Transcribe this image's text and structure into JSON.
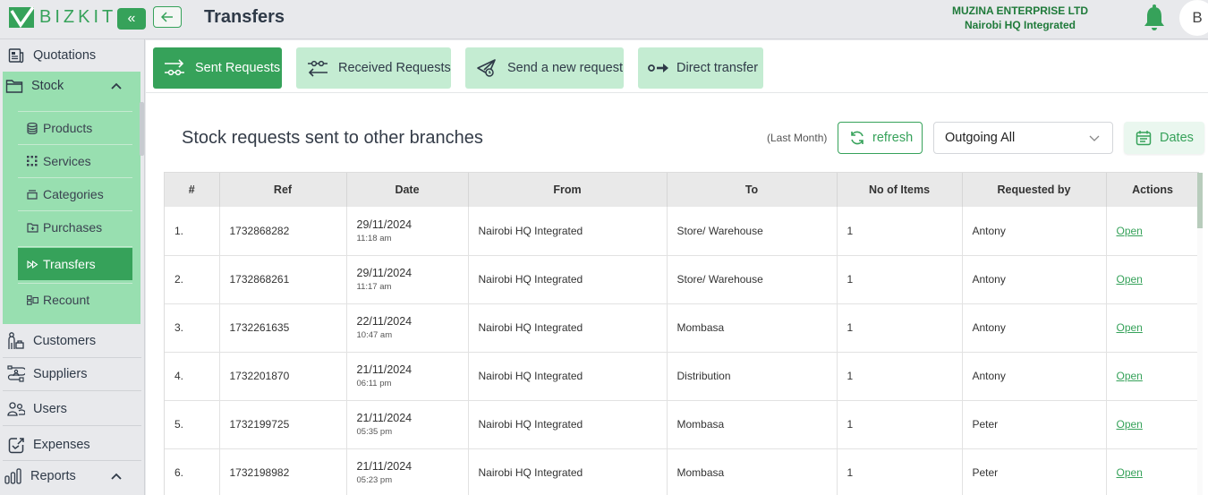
{
  "header": {
    "logo_text": "BIZKIT",
    "page_title": "Transfers",
    "company_name": "MUZINA ENTERPRISE LTD",
    "branch_name": "Nairobi HQ Integrated",
    "avatar_initial": "B",
    "icons": [
      "double-chevron-left-icon",
      "arrow-left-icon",
      "bell-icon"
    ]
  },
  "sidebar": {
    "items": [
      {
        "label": "Quotations",
        "icon": "document-icon"
      },
      {
        "label": "Stock",
        "icon": "folder-icon",
        "expanded": true
      },
      {
        "label": "Customers",
        "icon": "customer-icon"
      },
      {
        "label": "Suppliers",
        "icon": "supplier-icon"
      },
      {
        "label": "Users",
        "icon": "users-icon"
      },
      {
        "label": "Expenses",
        "icon": "expenses-icon"
      },
      {
        "label": "Reports",
        "icon": "bar-chart-icon",
        "expanded": true
      }
    ],
    "stock_sub_items": [
      {
        "label": "Products",
        "icon": "database-icon"
      },
      {
        "label": "Services",
        "icon": "grid-dots-icon"
      },
      {
        "label": "Categories",
        "icon": "box-icon"
      },
      {
        "label": "Purchases",
        "icon": "folder-plus-icon"
      },
      {
        "label": "Transfers",
        "icon": "fast-forward-icon",
        "active": true
      },
      {
        "label": "Recount",
        "icon": "recount-icon"
      }
    ]
  },
  "tabs": [
    {
      "label": "Sent Requests",
      "active": true
    },
    {
      "label": "Received Requests",
      "active": false
    },
    {
      "label": "Send a new request",
      "active": false
    },
    {
      "label": "Direct transfer",
      "active": false
    }
  ],
  "toolbar": {
    "section_title": "Stock requests sent to other branches",
    "period_label": "(Last Month)",
    "refresh_label": "refresh",
    "filter_selected": "Outgoing All",
    "dates_label": "Dates"
  },
  "table": {
    "columns": [
      "#",
      "Ref",
      "Date",
      "From",
      "To",
      "No of Items",
      "Requested by",
      "Actions"
    ],
    "rows": [
      {
        "num": "1.",
        "ref": "1732868282",
        "date": "29/11/2024",
        "time": "11:18 am",
        "from": "Nairobi HQ Integrated",
        "to": "Store/ Warehouse",
        "items": "1",
        "requested_by": "Antony",
        "action": "Open"
      },
      {
        "num": "2.",
        "ref": "1732868261",
        "date": "29/11/2024",
        "time": "11:17 am",
        "from": "Nairobi HQ Integrated",
        "to": "Store/ Warehouse",
        "items": "1",
        "requested_by": "Antony",
        "action": "Open"
      },
      {
        "num": "3.",
        "ref": "1732261635",
        "date": "22/11/2024",
        "time": "10:47 am",
        "from": "Nairobi HQ Integrated",
        "to": "Mombasa",
        "items": "1",
        "requested_by": "Antony",
        "action": "Open"
      },
      {
        "num": "4.",
        "ref": "1732201870",
        "date": "21/11/2024",
        "time": "06:11 pm",
        "from": "Nairobi HQ Integrated",
        "to": "Distribution",
        "items": "1",
        "requested_by": "Antony",
        "action": "Open"
      },
      {
        "num": "5.",
        "ref": "1732199725",
        "date": "21/11/2024",
        "time": "05:35 pm",
        "from": "Nairobi HQ Integrated",
        "to": "Mombasa",
        "items": "1",
        "requested_by": "Peter",
        "action": "Open"
      },
      {
        "num": "6.",
        "ref": "1732198982",
        "date": "21/11/2024",
        "time": "05:23 pm",
        "from": "Nairobi HQ Integrated",
        "to": "Mombasa",
        "items": "1",
        "requested_by": "Peter",
        "action": "Open"
      }
    ]
  },
  "colors": {
    "brand_green": "#36a25a",
    "sidebar_group_bg": "#98dfb0",
    "tab_inactive_bg": "#c4ecd2",
    "company_text": "#1f7a3a"
  }
}
